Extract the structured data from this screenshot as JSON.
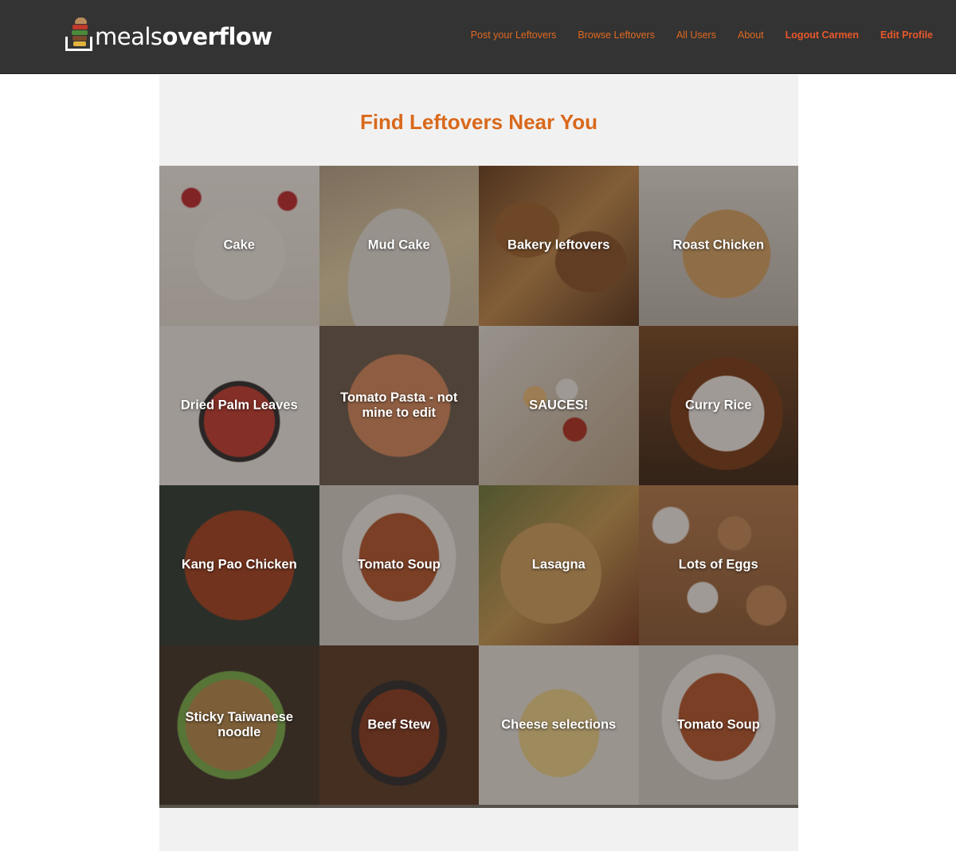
{
  "brand": {
    "name_light": "meals",
    "name_bold": "overflow"
  },
  "nav": [
    {
      "label": "Post your Leftovers",
      "strong": false
    },
    {
      "label": "Browse Leftovers",
      "strong": false
    },
    {
      "label": "All Users",
      "strong": false
    },
    {
      "label": "About",
      "strong": false
    },
    {
      "label": "Logout Carmen",
      "strong": true
    },
    {
      "label": "Edit Profile",
      "strong": true
    }
  ],
  "page": {
    "title": "Find Leftovers Near You"
  },
  "tiles": [
    {
      "label": "Cake",
      "image": "cake-photo"
    },
    {
      "label": "Mud Cake",
      "image": "mud-cake-photo"
    },
    {
      "label": "Bakery leftovers",
      "image": "bread-photo"
    },
    {
      "label": "Roast Chicken",
      "image": "roast-chicken-photo"
    },
    {
      "label": "Dried Palm Leaves",
      "image": "guard-cartoon-photo"
    },
    {
      "label": "Tomato Pasta - not mine to edit",
      "image": "pasta-photo"
    },
    {
      "label": "SAUCES!",
      "image": "sauces-photo"
    },
    {
      "label": "Curry Rice",
      "image": "curry-rice-photo"
    },
    {
      "label": "Kang Pao Chicken",
      "image": "kung-pao-photo"
    },
    {
      "label": "Tomato Soup",
      "image": "soup-photo"
    },
    {
      "label": "Lasagna",
      "image": "lasagna-photo"
    },
    {
      "label": "Lots of Eggs",
      "image": "eggs-photo"
    },
    {
      "label": "Sticky Taiwanese noodle",
      "image": "noodle-photo"
    },
    {
      "label": "Beef Stew",
      "image": "stew-photo"
    },
    {
      "label": "Cheese selections",
      "image": "cheese-photo"
    },
    {
      "label": "Tomato Soup",
      "image": "soup-photo"
    }
  ],
  "colors": {
    "accent": "#e2691f",
    "header": "#333333",
    "panel": "#f1f1f1"
  }
}
